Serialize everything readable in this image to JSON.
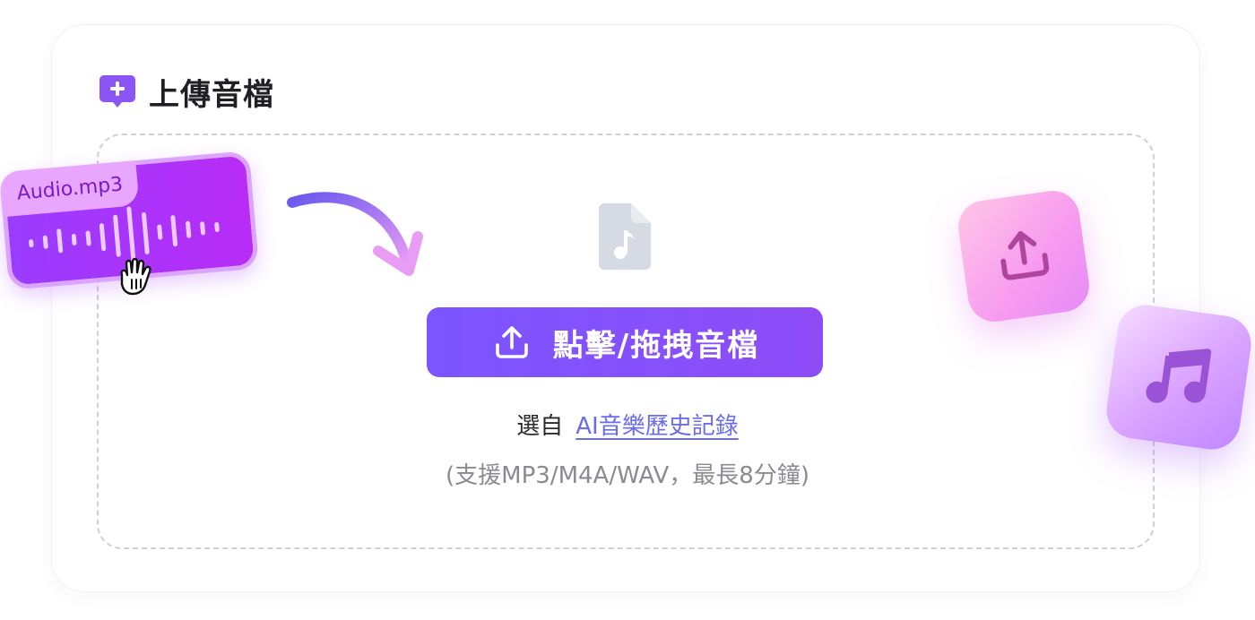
{
  "header": {
    "title": "上傳音檔",
    "icon": "add-upload-icon",
    "icon_color": "#8b55f6"
  },
  "dropzone": {
    "file_icon": "music-file-icon",
    "upload_button_label": "點擊/拖拽音檔",
    "upload_button_icon": "upload-icon",
    "choose_prefix": "選自",
    "history_link": "AI音樂歷史記錄",
    "support_text": "(支援MP3/M4A/WAV，最長8分鐘)"
  },
  "audio_card": {
    "filename": "Audio.mp3",
    "icon": "waveform-icon"
  },
  "decorations": {
    "cursor": "hand-cursor-icon",
    "arrow": "curved-arrow-icon",
    "upload_tile_icon": "upload-icon",
    "music_tile_icon": "music-note-icon"
  },
  "colors": {
    "accent": "#7b55ff",
    "link": "#6a6cf0",
    "muted": "#8a8a92"
  }
}
